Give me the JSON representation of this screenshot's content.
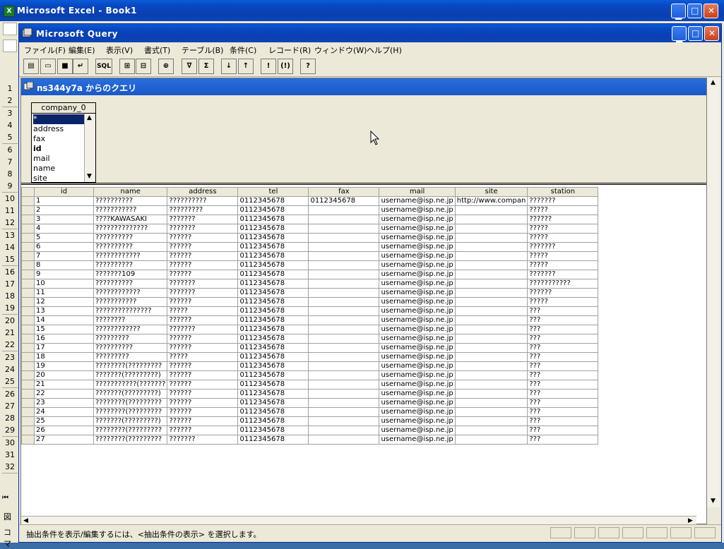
{
  "excel": {
    "title": "Microsoft Excel - Book1",
    "row_numbers": [
      "1",
      "2",
      "3",
      "4",
      "5",
      "6",
      "7",
      "8",
      "9",
      "10",
      "11",
      "12",
      "13",
      "14",
      "15",
      "16",
      "17",
      "18",
      "19",
      "20",
      "21",
      "22",
      "23",
      "24",
      "25",
      "26",
      "27",
      "28",
      "29",
      "30",
      "31",
      "32"
    ],
    "bottom_left": [
      "図",
      "コマ"
    ]
  },
  "query": {
    "title": "Microsoft Query",
    "menu": [
      "ファイル(F)",
      "編集(E)",
      "表示(V)",
      "書式(T)",
      "テーブル(B)",
      "条件(C)",
      "レコード(R)",
      "ウィンドウ(W)",
      "ヘルプ(H)"
    ],
    "toolbar": [
      "new-query",
      "open",
      "save",
      "return-data",
      "SQL",
      "show-tables",
      "show-criteria",
      "add-tables",
      "filter",
      "totals",
      "sort-asc",
      "sort-desc",
      "query-now",
      "auto-query",
      "help"
    ],
    "toolbar_sql_label": "SQL",
    "child_title": "ns344y7a からのクエリ",
    "table": {
      "name": "company_0",
      "fields": [
        "*",
        "address",
        "fax",
        "id",
        "mail",
        "name",
        "site"
      ]
    },
    "grid": {
      "columns": [
        "id",
        "name",
        "address",
        "tel",
        "fax",
        "mail",
        "site",
        "station"
      ],
      "rows": [
        [
          "1",
          "??????????",
          "??????????",
          "0112345678",
          "0112345678",
          "username@isp.ne.jp",
          "http://www.compan",
          "???????"
        ],
        [
          "2",
          "???????????",
          "?????????",
          "0112345678",
          "",
          "username@isp.ne.jp",
          "",
          "?????"
        ],
        [
          "3",
          "????KAWASAKI",
          "???????",
          "0112345678",
          "",
          "username@isp.ne.jp",
          "",
          "??????"
        ],
        [
          "4",
          "??????????????",
          "???????",
          "0112345678",
          "",
          "username@isp.ne.jp",
          "",
          "?????"
        ],
        [
          "5",
          "??????????",
          "??????",
          "0112345678",
          "",
          "username@isp.ne.jp",
          "",
          "?????"
        ],
        [
          "6",
          "??????????",
          "??????",
          "0112345678",
          "",
          "username@isp.ne.jp",
          "",
          "???????"
        ],
        [
          "7",
          "????????????",
          "??????",
          "0112345678",
          "",
          "username@isp.ne.jp",
          "",
          "?????"
        ],
        [
          "8",
          "??????????",
          "??????",
          "0112345678",
          "",
          "username@isp.ne.jp",
          "",
          "?????"
        ],
        [
          "9",
          "???????109",
          "??????",
          "0112345678",
          "",
          "username@isp.ne.jp",
          "",
          "???????"
        ],
        [
          "10",
          "??????????",
          "???????",
          "0112345678",
          "",
          "username@isp.ne.jp",
          "",
          "???????????"
        ],
        [
          "11",
          "????????????",
          "???????",
          "0112345678",
          "",
          "username@isp.ne.jp",
          "",
          "??????"
        ],
        [
          "12",
          "???????????",
          "??????",
          "0112345678",
          "",
          "username@isp.ne.jp",
          "",
          "?????"
        ],
        [
          "13",
          "???????????????",
          "?????",
          "0112345678",
          "",
          "username@isp.ne.jp",
          "",
          "???"
        ],
        [
          "14",
          "????????",
          "??????",
          "0112345678",
          "",
          "username@isp.ne.jp",
          "",
          "???"
        ],
        [
          "15",
          "????????????",
          "???????",
          "0112345678",
          "",
          "username@isp.ne.jp",
          "",
          "???"
        ],
        [
          "16",
          "?????????",
          "??????",
          "0112345678",
          "",
          "username@isp.ne.jp",
          "",
          "???"
        ],
        [
          "17",
          "??????????",
          "??????",
          "0112345678",
          "",
          "username@isp.ne.jp",
          "",
          "???"
        ],
        [
          "18",
          "?????????",
          "?????",
          "0112345678",
          "",
          "username@isp.ne.jp",
          "",
          "???"
        ],
        [
          "19",
          "????????(?????????",
          "??????",
          "0112345678",
          "",
          "username@isp.ne.jp",
          "",
          "???"
        ],
        [
          "20",
          "???????(?????????)",
          "??????",
          "0112345678",
          "",
          "username@isp.ne.jp",
          "",
          "???"
        ],
        [
          "21",
          "???????????(???????",
          "??????",
          "0112345678",
          "",
          "username@isp.ne.jp",
          "",
          "???"
        ],
        [
          "22",
          "???????(?????????)",
          "??????",
          "0112345678",
          "",
          "username@isp.ne.jp",
          "",
          "???"
        ],
        [
          "23",
          "????????(?????????",
          "??????",
          "0112345678",
          "",
          "username@isp.ne.jp",
          "",
          "???"
        ],
        [
          "24",
          "????????(?????????",
          "??????",
          "0112345678",
          "",
          "username@isp.ne.jp",
          "",
          "???"
        ],
        [
          "25",
          "???????(?????????)",
          "??????",
          "0112345678",
          "",
          "username@isp.ne.jp",
          "",
          "???"
        ],
        [
          "26",
          "????????(?????????",
          "??????",
          "0112345678",
          "",
          "username@isp.ne.jp",
          "",
          "???"
        ],
        [
          "27",
          "????????(?????????",
          "???????",
          "0112345678",
          "",
          "username@isp.ne.jp",
          "",
          "???"
        ]
      ]
    },
    "status_message": "抽出条件を表示/編集するには、<抽出条件の表示> を選択します。"
  }
}
